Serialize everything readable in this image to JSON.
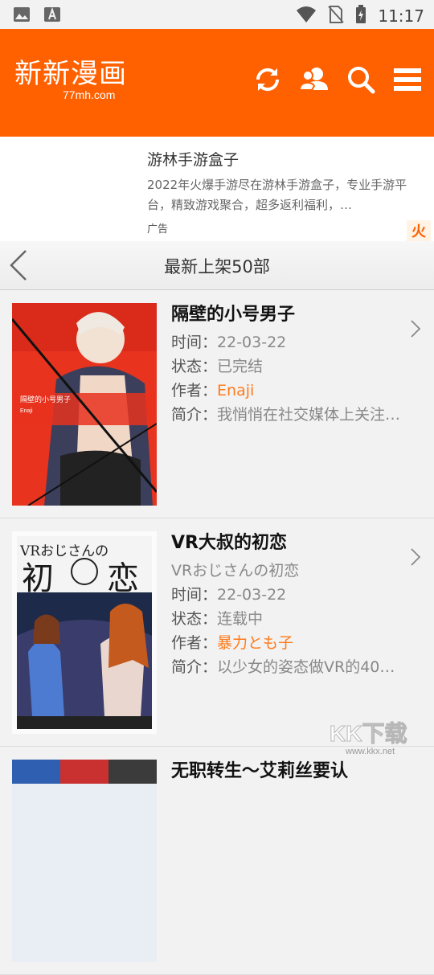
{
  "status_bar": {
    "time": "11:17",
    "left_icons": [
      "image-icon",
      "font-icon"
    ],
    "right_icons": [
      "wifi-icon",
      "no-sim-icon",
      "battery-charging-icon"
    ]
  },
  "header": {
    "logo_title": "新新漫画",
    "logo_subtitle": "77mh.com",
    "icons": [
      "refresh-icon",
      "users-icon",
      "search-icon",
      "menu-icon"
    ],
    "accent_color": "#ff6000"
  },
  "ad": {
    "title": "游林手游盒子",
    "description": "2022年火爆手游尽在游林手游盒子，专业手游平台，精致游戏聚合，超多返利福利，…",
    "label": "广告",
    "badge": "火"
  },
  "titlebar": {
    "title": "最新上架50部"
  },
  "labels": {
    "time": "时间：",
    "status": "状态：",
    "author": "作者：",
    "intro": "简介："
  },
  "items": [
    {
      "title": "隔壁的小号男子",
      "time": "22-03-22",
      "status": "已完结",
      "author": "Enaji",
      "intro": "我悄悄在社交媒体上关注…",
      "cover_text": [
        "隔壁的小号男子",
        "Enaji"
      ]
    },
    {
      "title": "VR大叔的初恋",
      "alt_title": "VRおじさんの初恋",
      "time": "22-03-22",
      "status": "连载中",
      "author": "暴力とも子",
      "intro": "以少女的姿态做VR的40…",
      "cover_text": [
        "VRおじさんの",
        "初",
        "恋"
      ]
    },
    {
      "title": "无职转生～艾莉丝要认"
    }
  ],
  "watermark": {
    "text": "KK下载",
    "url": "www.kkx.net"
  }
}
